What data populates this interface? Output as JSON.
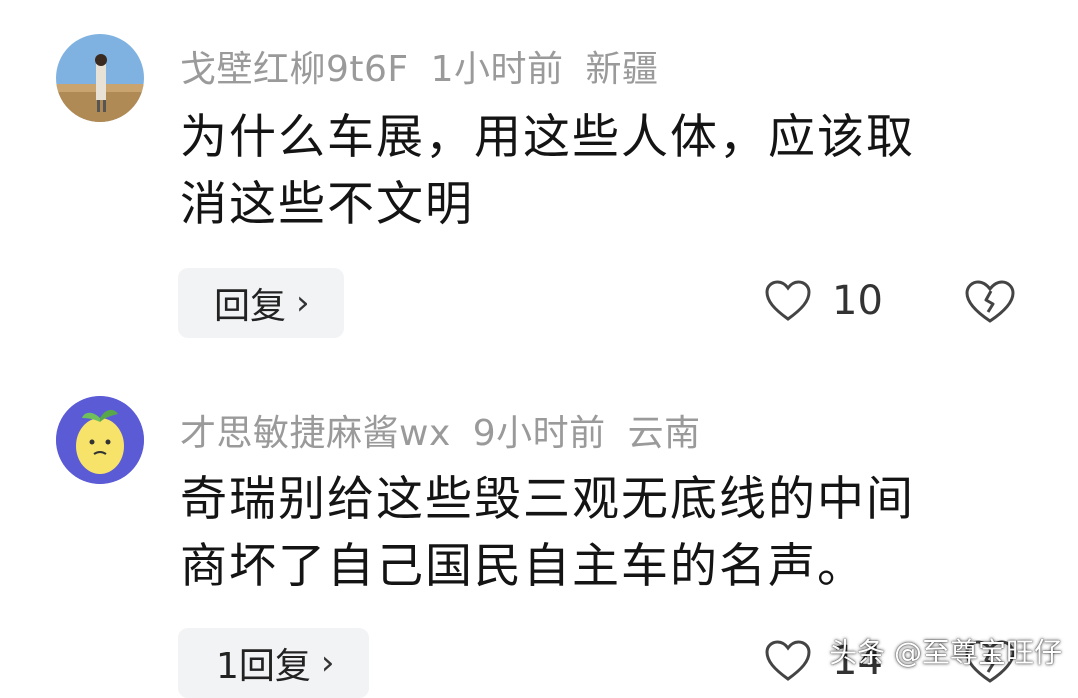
{
  "comments": [
    {
      "username": "戈壁红柳9t6F",
      "time": "1小时前",
      "location": "新疆",
      "text_line1": "为什么车展，用这些人体，应该取",
      "text_line2": "消这些不文明",
      "reply_label": "回复",
      "likes": "10"
    },
    {
      "username": "才思敏捷麻酱wx",
      "time": "9小时前",
      "location": "云南",
      "text_line1": "奇瑞别给这些毁三观无底线的中间",
      "text_line2": "商坏了自己国民自主车的名声。",
      "reply_label": "1回复",
      "likes": "14"
    }
  ],
  "watermark": "头条 @至尊宝旺仔",
  "colors": {
    "meta_text": "#9a9a9a",
    "body_text": "#141414",
    "reply_bg": "#f2f3f5",
    "avatar2_bg": "#5b5bd6"
  }
}
